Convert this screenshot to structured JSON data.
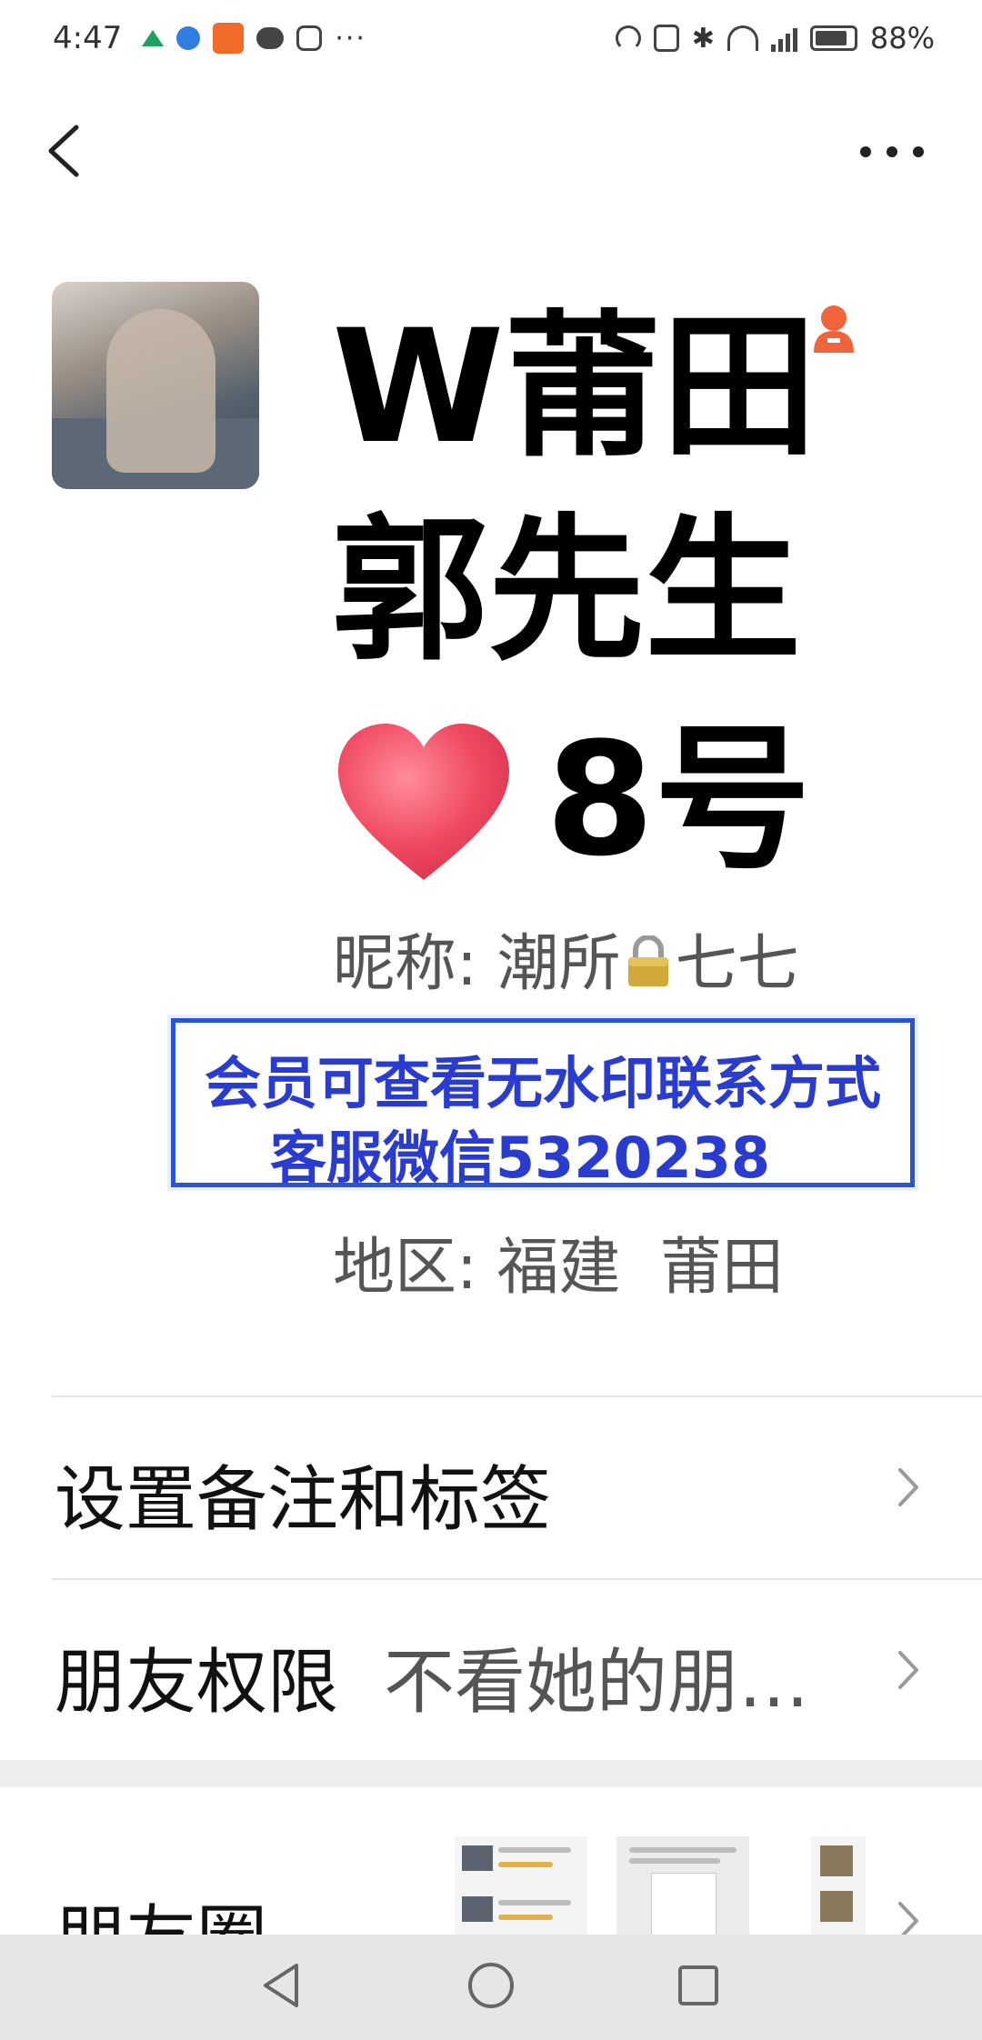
{
  "status_bar": {
    "time": "4:47",
    "dots": "···",
    "battery": "88%",
    "bluetooth_glyph": "✱",
    "icons_left": [
      "mountain-icon",
      "globe-icon",
      "app-square-icon",
      "chat-bubble-icon",
      "hand-icon"
    ],
    "icons_right": [
      "gauge-icon",
      "nfc-icon",
      "bluetooth-icon",
      "wifi-icon",
      "signal-icon",
      "battery-icon"
    ]
  },
  "nav": {
    "back_icon": "chevron-left-icon",
    "more_icon": "more-dots-icon"
  },
  "profile": {
    "name_line_1": "W莆田",
    "name_line_2": "郭先生",
    "name_line_3": "8号",
    "heart_icon": "heart-icon",
    "badge_icon": "person-badge-icon",
    "nickname_label": "昵称:",
    "nickname_before_lock": "潮所",
    "nickname_after_lock": "七七",
    "region_label": "地区:",
    "region_value": "福建  莆田"
  },
  "watermark": {
    "line_1": "会员可查看无水印联系方式",
    "line_2": "客服微信5320238"
  },
  "menu": {
    "remark_label": "设置备注和标签",
    "permissions_label": "朋友权限",
    "permissions_value": "不看她的朋…",
    "moments_label": "朋友圈"
  },
  "colors": {
    "accent_badge": "#f0643c",
    "watermark_blue": "#2a3bd0",
    "heart": "#f04a63"
  }
}
